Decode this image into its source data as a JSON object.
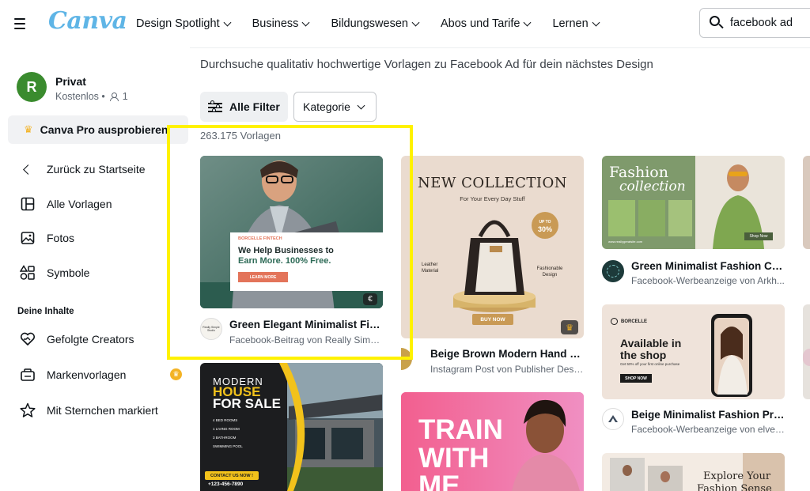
{
  "header": {
    "logo": "Canva",
    "nav": [
      {
        "label": "Design Spotlight"
      },
      {
        "label": "Business"
      },
      {
        "label": "Bildungswesen"
      },
      {
        "label": "Abos und Tarife"
      },
      {
        "label": "Lernen"
      }
    ],
    "search_value": "facebook ad"
  },
  "sidebar": {
    "avatar_letter": "R",
    "account_name": "Privat",
    "account_plan": "Kostenlos •",
    "member_count": "1",
    "pro_label": "Canva Pro ausprobieren",
    "back_label": "Zurück zu Startseite",
    "items": [
      {
        "label": "Alle Vorlagen",
        "icon": "layout-icon"
      },
      {
        "label": "Fotos",
        "icon": "image-icon"
      },
      {
        "label": "Symbole",
        "icon": "shapes-icon"
      }
    ],
    "section_label": "Deine Inhalte",
    "content_items": [
      {
        "label": "Gefolgte Creators",
        "icon": "heart-handshake-icon"
      },
      {
        "label": "Markenvorlagen",
        "icon": "brand-kit-icon"
      },
      {
        "label": "Mit Sternchen markiert",
        "icon": "star-icon"
      }
    ]
  },
  "main": {
    "description": "Durchsuche qualitativ hochwertige Vorlagen zu Facebook Ad für dein nächstes Design",
    "filter_label": "Alle Filter",
    "category_label": "Kategorie",
    "count": "263.175 Vorlagen",
    "cards": [
      {
        "title": "Green Elegant Minimalist Fin...",
        "subtitle": "Facebook-Beitrag von Really Simpl...",
        "thumb": {
          "brand": "BORCELLE FINTECH",
          "headline1": "We Help Businesses to",
          "headline2": "Earn More. 100% Free.",
          "cta": "LEARN MORE",
          "badge": "€"
        },
        "logo_text": "Really Simple Studio"
      },
      {
        "title": "Beige Brown Modern Hand B...",
        "subtitle": "Instagram Post von Publisher Desi...",
        "thumb": {
          "heading": "NEW COLLECTION",
          "sub": "For Your Every Day Stuff",
          "price_label": "UP TO",
          "price": "30%",
          "left_label": "Leather Material",
          "right_label": "Fashionable Design",
          "cta": "BUY NOW"
        }
      },
      {
        "title": "Green Minimalist Fashion Co...",
        "subtitle": "Facebook-Werbeanzeige von Arkh...",
        "thumb": {
          "heading1": "Fashion",
          "heading2": "collection",
          "url": "www.reallygreatsite.com",
          "cta": "Shop Now"
        }
      },
      {
        "title": "Beige Minimalist Fashion Pro...",
        "subtitle": "Facebook-Werbeanzeige von elver...",
        "thumb": {
          "brand": "BORCELLE",
          "heading1": "Available in",
          "heading2": "the shop",
          "sub": "Get 50% off your first online purchase",
          "cta": "SHOP NOW"
        }
      },
      {
        "thumb": {
          "line1": "MODERN",
          "line2": "HOUSE",
          "line3": "FOR SALE",
          "features": [
            "4 BED ROOMS",
            "1 LIVING ROOM",
            "3 BATHROOM",
            "SWIMMING POOL"
          ],
          "cta": "CONTACT US NOW !",
          "phone": "+123-456-7890"
        }
      },
      {
        "thumb": {
          "line1": "TRAIN",
          "line2": "WITH",
          "line3": "ME"
        }
      },
      {
        "thumb": {
          "line1": "Explore Your",
          "line2": "Fashion Sense"
        }
      }
    ]
  },
  "colors": {
    "accent_yellow": "#fff200",
    "canva_blue": "#5fb5e6",
    "avatar_green": "#3a8b2e",
    "crown_gold": "#f3b325"
  }
}
